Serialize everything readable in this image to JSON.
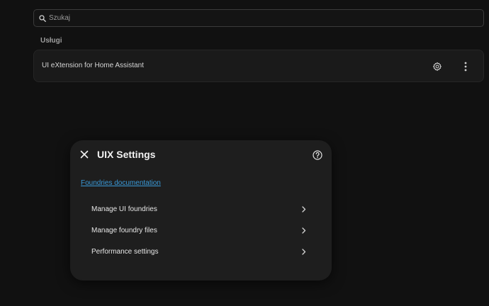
{
  "search": {
    "placeholder": "Szukaj",
    "value": ""
  },
  "section": {
    "label": "Usługi"
  },
  "service": {
    "name": "UI eXtension for Home Assistant",
    "icons": [
      "gear-icon",
      "more-vert-icon"
    ]
  },
  "dialog": {
    "title": "UIX Settings",
    "close_icon": "close-icon",
    "help_icon": "help-icon",
    "doc_link": "Foundries documentation",
    "items": [
      {
        "label": "Manage UI foundries"
      },
      {
        "label": "Manage foundry files"
      },
      {
        "label": "Performance settings"
      }
    ]
  },
  "colors": {
    "background": "#111111",
    "card": "#1a1a1a",
    "dialog": "#1e1e1e",
    "link": "#3a9ad9",
    "text": "#e1e1e1"
  }
}
